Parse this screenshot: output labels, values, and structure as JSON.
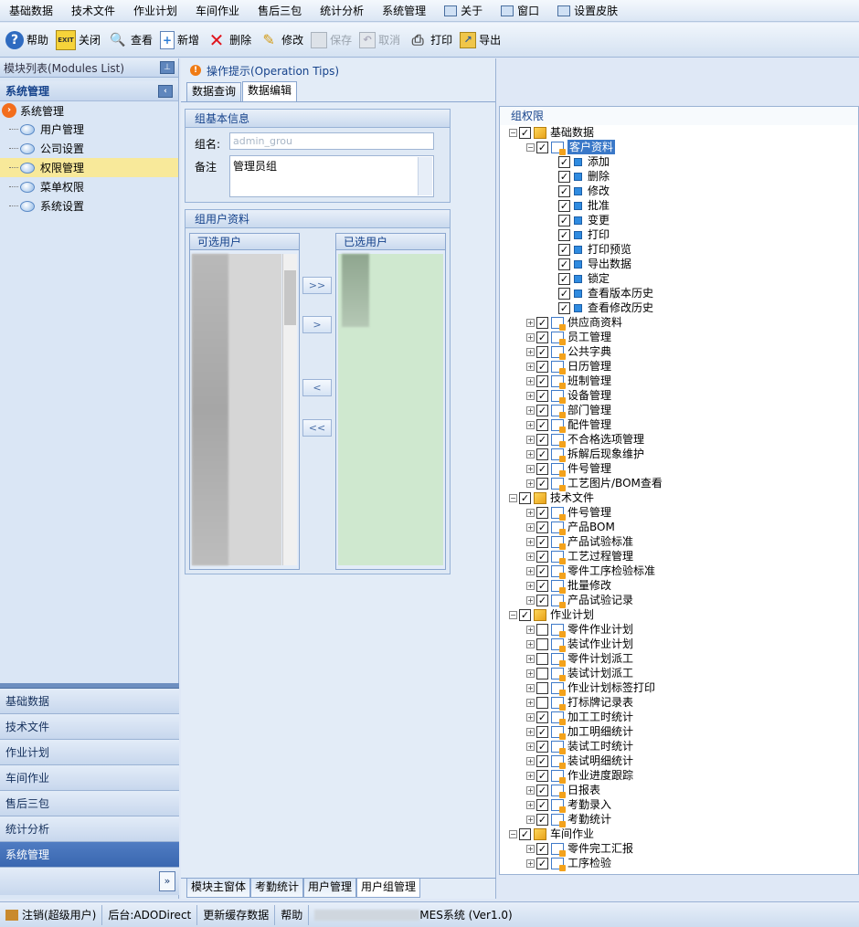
{
  "menubar": {
    "items": [
      "基础数据",
      "技术文件",
      "作业计划",
      "车间作业",
      "售后三包",
      "统计分析",
      "系统管理"
    ],
    "about": "关于",
    "window": "窗口",
    "skin": "设置皮肤"
  },
  "toolbar": {
    "help": "帮助",
    "close": "关闭",
    "view": "查看",
    "add": "新增",
    "delete": "删除",
    "edit": "修改",
    "save": "保存",
    "cancel": "取消",
    "print": "打印",
    "export": "导出"
  },
  "left": {
    "modules_title": "模块列表(Modules List)",
    "section_title": "系统管理",
    "root": "系统管理",
    "items": [
      "用户管理",
      "公司设置",
      "权限管理",
      "菜单权限",
      "系统设置"
    ],
    "nav": [
      "基础数据",
      "技术文件",
      "作业计划",
      "车间作业",
      "售后三包",
      "统计分析",
      "系统管理"
    ]
  },
  "center": {
    "tips": "操作提示(Operation Tips)",
    "tabs": [
      "数据查询",
      "数据编辑"
    ],
    "basic_title": "组基本信息",
    "name_label": "组名:",
    "name_value": "admin_grou",
    "remark_label": "备注",
    "remark_value": "管理员组",
    "users_title": "组用户资料",
    "available_label": "可选用户",
    "selected_label": "已选用户",
    "buttons": [
      ">>",
      ">",
      "<",
      "<<"
    ],
    "bottom_tabs": [
      "模块主窗体",
      "考勤统计",
      "用户管理",
      "用户组管理"
    ]
  },
  "perm": {
    "title": "组权限",
    "groups": [
      {
        "name": "基础数据",
        "children": [
          "客户资料",
          "供应商资料",
          "员工管理",
          "公共字典",
          "日历管理",
          "班制管理",
          "设备管理",
          "部门管理",
          "配件管理",
          "不合格选项管理",
          "拆解后现象维护",
          "件号管理",
          "工艺图片/BOM查看"
        ],
        "leaf_actions": [
          "添加",
          "删除",
          "修改",
          "批准",
          "变更",
          "打印",
          "打印预览",
          "导出数据",
          "锁定",
          "查看版本历史",
          "查看修改历史"
        ]
      },
      {
        "name": "技术文件",
        "children": [
          "件号管理",
          "产品BOM",
          "产品试验标准",
          "工艺过程管理",
          "零件工序检验标准",
          "批量修改",
          "产品试验记录"
        ]
      },
      {
        "name": "作业计划",
        "children": [
          "零件作业计划",
          "装试作业计划",
          "零件计划派工",
          "装试计划派工",
          "作业计划标签打印",
          "打标牌记录表",
          "加工工时统计",
          "加工明细统计",
          "装试工时统计",
          "装试明细统计",
          "作业进度跟踪",
          "日报表",
          "考勤录入",
          "考勤统计"
        ],
        "unchecked": [
          "零件作业计划",
          "装试作业计划",
          "零件计划派工",
          "装试计划派工",
          "作业计划标签打印",
          "打标牌记录表"
        ]
      },
      {
        "name": "车间作业",
        "children": [
          "零件完工汇报",
          "工序检验"
        ]
      }
    ]
  },
  "status": {
    "logout": "注销(超级用户)",
    "backend": "后台:ADODirect",
    "refresh": "更新缓存数据",
    "help": "帮助",
    "app": "MES系统",
    "version": "(Ver1.0)"
  }
}
